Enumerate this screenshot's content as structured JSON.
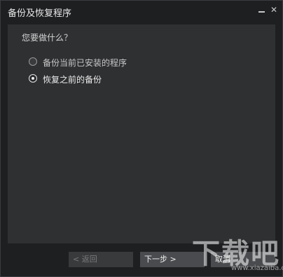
{
  "window": {
    "title": "备份及恢复程序",
    "minimize_icon": "minimize-icon",
    "close_icon": "close-icon",
    "close_glyph": "✕"
  },
  "wizard": {
    "question": "您要做什么？",
    "options": [
      {
        "label": "备份当前已安装的程序",
        "selected": false
      },
      {
        "label": "恢复之前的备份",
        "selected": true
      }
    ]
  },
  "footer": {
    "back_label": "< 返回",
    "next_label": "下一步 >",
    "cancel_label": "取消",
    "back_enabled": false
  },
  "watermark": {
    "text": "下载吧",
    "url": "www.xiazaiba.com"
  },
  "colors": {
    "window_bg": "#1e1f21",
    "panel_bg": "#2f3032",
    "button_bg": "#4a4b4e",
    "button_disabled_bg": "#393a3c"
  }
}
